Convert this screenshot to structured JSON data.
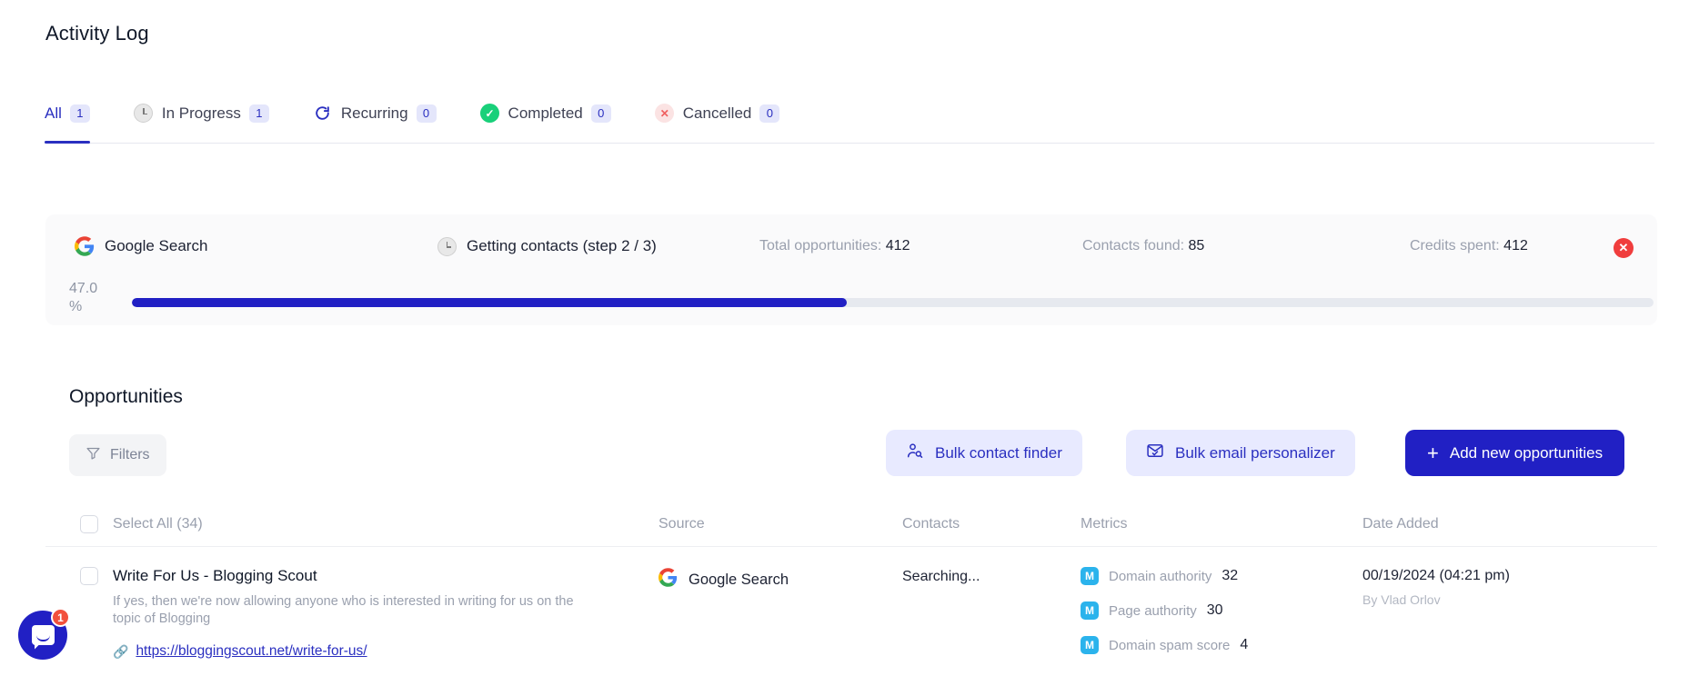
{
  "header": {
    "title": "Activity Log"
  },
  "tabs": [
    {
      "label": "All",
      "count": "1",
      "icon": "none",
      "active": true
    },
    {
      "label": "In Progress",
      "count": "1",
      "icon": "clock-icon",
      "active": false
    },
    {
      "label": "Recurring",
      "count": "0",
      "icon": "refresh-icon",
      "active": false
    },
    {
      "label": "Completed",
      "count": "0",
      "icon": "check-circle-icon",
      "active": false
    },
    {
      "label": "Cancelled",
      "count": "0",
      "icon": "x-circle-icon",
      "active": false
    }
  ],
  "progress_card": {
    "source_label": "Google Search",
    "source_icon": "google-icon",
    "step_label": "Getting contacts (step 2 / 3)",
    "step_icon": "clock-icon",
    "stats": [
      {
        "label": "Total opportunities:",
        "value": "412"
      },
      {
        "label": "Contacts found:",
        "value": "85"
      },
      {
        "label": "Credits spent:",
        "value": "412"
      }
    ],
    "close_icon": "close-icon",
    "percent_label": "47.0 %",
    "percent_value": 47.0,
    "bar_color": "#2120c4",
    "track_color": "#e6e9ef"
  },
  "opportunities": {
    "title": "Opportunities",
    "filters_label": "Filters",
    "filters_icon": "funnel-icon",
    "actions": [
      {
        "label": "Bulk contact finder",
        "icon": "user-search-icon"
      },
      {
        "label": "Bulk email personalizer",
        "icon": "mail-check-icon"
      },
      {
        "label": "Add new opportunities",
        "icon": "plus-icon"
      }
    ],
    "table": {
      "select_all_label": "Select All (34)",
      "columns": [
        "Source",
        "Contacts",
        "Metrics",
        "Date Added"
      ],
      "rows": [
        {
          "title": "Write For Us - Blogging Scout",
          "description": "If yes, then we're now allowing anyone who is interested in writing for us on the topic of Blogging",
          "link": "https://bloggingscout.net/write-for-us/",
          "source": "Google Search",
          "source_icon": "google-icon",
          "contacts": "Searching...",
          "metrics": [
            {
              "icon": "moz-icon",
              "label": "Domain authority",
              "value": "32"
            },
            {
              "icon": "moz-icon",
              "label": "Page authority",
              "value": "30"
            },
            {
              "icon": "moz-icon",
              "label": "Domain spam score",
              "value": "4"
            }
          ],
          "date": "00/19/2024 (04:21 pm)",
          "author": "By Vlad Orlov"
        }
      ]
    }
  },
  "chat": {
    "badge": "1",
    "icon": "chat-bubble-icon"
  },
  "colors": {
    "accent": "#2120c4",
    "accent_soft_bg": "#e8eaff",
    "danger": "#f03d3d",
    "success": "#19d07a",
    "moz": "#2bb3ec"
  }
}
